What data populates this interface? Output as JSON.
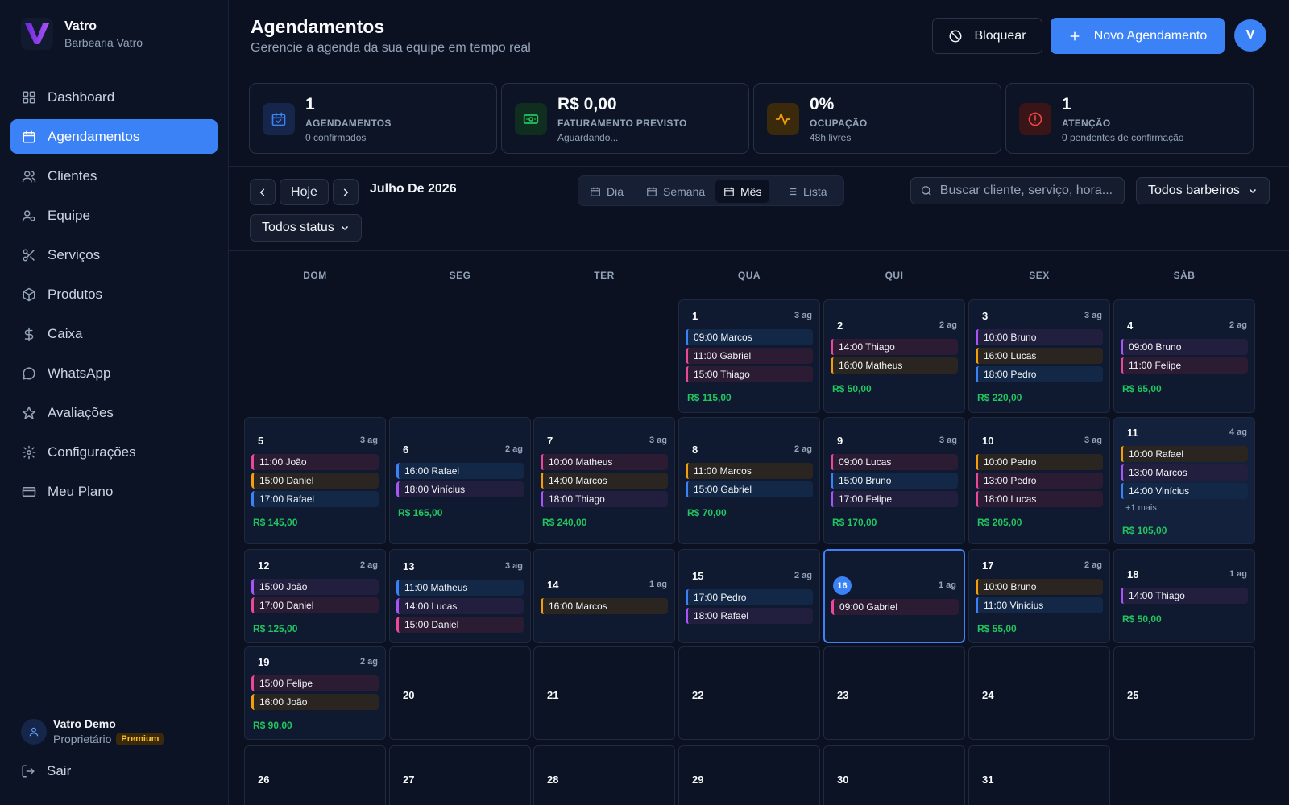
{
  "brand": {
    "name": "Vatro",
    "subtitle": "Barbearia Vatro"
  },
  "nav": [
    {
      "label": "Dashboard",
      "icon": "grid-icon"
    },
    {
      "label": "Agendamentos",
      "icon": "calendar-icon",
      "active": true
    },
    {
      "label": "Clientes",
      "icon": "users-icon"
    },
    {
      "label": "Equipe",
      "icon": "user-cog-icon"
    },
    {
      "label": "Serviços",
      "icon": "scissors-icon"
    },
    {
      "label": "Produtos",
      "icon": "package-icon"
    },
    {
      "label": "Caixa",
      "icon": "dollar-icon"
    },
    {
      "label": "WhatsApp",
      "icon": "message-icon"
    },
    {
      "label": "Avaliações",
      "icon": "star-icon"
    },
    {
      "label": "Configurações",
      "icon": "gear-icon"
    },
    {
      "label": "Meu Plano",
      "icon": "credit-card-icon"
    }
  ],
  "user": {
    "name": "Vatro Demo",
    "role": "Proprietário",
    "badge": "Premium",
    "logout": "Sair"
  },
  "header": {
    "title": "Agendamentos",
    "subtitle": "Gerencie a agenda da sua equipe em tempo real",
    "block_label": "Bloquear",
    "new_label": "Novo Agendamento",
    "avatar": "V"
  },
  "stats": [
    {
      "value": "1",
      "label": "AGENDAMENTOS",
      "sub": "0 confirmados",
      "icon": "calendar-check-icon",
      "color": "#3b82f6"
    },
    {
      "value": "R$ 0,00",
      "label": "FATURAMENTO PREVISTO",
      "sub": "Aguardando...",
      "icon": "banknote-icon",
      "color": "#22c55e"
    },
    {
      "value": "0%",
      "label": "OCUPAÇÃO",
      "sub": "48h livres",
      "icon": "activity-icon",
      "color": "#f59e0b"
    },
    {
      "value": "1",
      "label": "ATENÇÃO",
      "sub": "0 pendentes de confirmação",
      "icon": "alert-circle-icon",
      "color": "#ef4444"
    }
  ],
  "toolbar": {
    "today": "Hoje",
    "month": "Julho De 2026",
    "views": [
      "Dia",
      "Semana",
      "Mês",
      "Lista"
    ],
    "active_view": "Mês",
    "search_placeholder": "Buscar cliente, serviço, hora...",
    "barber_filter": "Todos barbeiros",
    "status_filter": "Todos status"
  },
  "calendar": {
    "weekdays": [
      "DOM",
      "SEG",
      "TER",
      "QUA",
      "QUI",
      "SEX",
      "SÁB"
    ],
    "colors": {
      "pink": "#ec4899",
      "orange": "#f59e0b",
      "blue": "#3b82f6",
      "purple": "#a855f7"
    },
    "days": [
      {
        "n": "1",
        "count": "3 ag",
        "appts": [
          [
            "09:00 Marcos",
            "blue"
          ],
          [
            "11:00 Gabriel",
            "pink"
          ],
          [
            "15:00 Thiago",
            "pink"
          ]
        ],
        "rev": "R$ 115,00"
      },
      {
        "n": "2",
        "count": "2 ag",
        "appts": [
          [
            "14:00 Thiago",
            "pink"
          ],
          [
            "16:00 Matheus",
            "orange"
          ]
        ],
        "rev": "R$ 50,00"
      },
      {
        "n": "3",
        "count": "3 ag",
        "appts": [
          [
            "10:00 Bruno",
            "purple"
          ],
          [
            "16:00 Lucas",
            "orange"
          ],
          [
            "18:00 Pedro",
            "blue"
          ]
        ],
        "rev": "R$ 220,00"
      },
      {
        "n": "4",
        "count": "2 ag",
        "appts": [
          [
            "09:00 Bruno",
            "purple"
          ],
          [
            "11:00 Felipe",
            "pink"
          ]
        ],
        "rev": "R$ 65,00"
      },
      {
        "n": "5",
        "count": "3 ag",
        "appts": [
          [
            "11:00 João",
            "pink"
          ],
          [
            "15:00 Daniel",
            "orange"
          ],
          [
            "17:00 Rafael",
            "blue"
          ]
        ],
        "rev": "R$ 145,00"
      },
      {
        "n": "6",
        "count": "2 ag",
        "appts": [
          [
            "16:00 Rafael",
            "blue"
          ],
          [
            "18:00 Vinícius",
            "purple"
          ]
        ],
        "rev": "R$ 165,00"
      },
      {
        "n": "7",
        "count": "3 ag",
        "appts": [
          [
            "10:00 Matheus",
            "pink"
          ],
          [
            "14:00 Marcos",
            "orange"
          ],
          [
            "18:00 Thiago",
            "purple"
          ]
        ],
        "rev": "R$ 240,00"
      },
      {
        "n": "8",
        "count": "2 ag",
        "appts": [
          [
            "11:00 Marcos",
            "orange"
          ],
          [
            "15:00 Gabriel",
            "blue"
          ]
        ],
        "rev": "R$ 70,00"
      },
      {
        "n": "9",
        "count": "3 ag",
        "appts": [
          [
            "09:00 Lucas",
            "pink"
          ],
          [
            "15:00 Bruno",
            "blue"
          ],
          [
            "17:00 Felipe",
            "purple"
          ]
        ],
        "rev": "R$ 170,00"
      },
      {
        "n": "10",
        "count": "3 ag",
        "appts": [
          [
            "10:00 Pedro",
            "orange"
          ],
          [
            "13:00 Pedro",
            "pink"
          ],
          [
            "18:00 Lucas",
            "pink"
          ]
        ],
        "rev": "R$ 205,00"
      },
      {
        "n": "11",
        "count": "4 ag",
        "appts": [
          [
            "10:00 Rafael",
            "orange"
          ],
          [
            "13:00 Marcos",
            "purple"
          ],
          [
            "14:00 Vinícius",
            "blue"
          ]
        ],
        "more": "+1 mais",
        "rev": "R$ 105,00",
        "highlight": true
      },
      {
        "n": "12",
        "count": "2 ag",
        "appts": [
          [
            "15:00 João",
            "purple"
          ],
          [
            "17:00 Daniel",
            "pink"
          ]
        ],
        "rev": "R$ 125,00"
      },
      {
        "n": "13",
        "count": "3 ag",
        "appts": [
          [
            "11:00 Matheus",
            "blue"
          ],
          [
            "14:00 Lucas",
            "purple"
          ],
          [
            "15:00 Daniel",
            "pink"
          ]
        ],
        "rev": ""
      },
      {
        "n": "14",
        "count": "1 ag",
        "appts": [
          [
            "16:00 Marcos",
            "orange"
          ]
        ],
        "rev": ""
      },
      {
        "n": "15",
        "count": "2 ag",
        "appts": [
          [
            "17:00 Pedro",
            "blue"
          ],
          [
            "18:00 Rafael",
            "purple"
          ]
        ],
        "rev": ""
      },
      {
        "n": "16",
        "count": "1 ag",
        "appts": [
          [
            "09:00 Gabriel",
            "pink"
          ]
        ],
        "rev": "",
        "today": true
      },
      {
        "n": "17",
        "count": "2 ag",
        "appts": [
          [
            "10:00 Bruno",
            "orange"
          ],
          [
            "11:00 Vinícius",
            "blue"
          ]
        ],
        "rev": "R$ 55,00"
      },
      {
        "n": "18",
        "count": "1 ag",
        "appts": [
          [
            "14:00 Thiago",
            "purple"
          ]
        ],
        "rev": "R$ 50,00"
      },
      {
        "n": "19",
        "count": "2 ag",
        "appts": [
          [
            "15:00 Felipe",
            "pink"
          ],
          [
            "16:00 João",
            "orange"
          ]
        ],
        "rev": "R$ 90,00"
      },
      {
        "n": "20"
      },
      {
        "n": "21"
      },
      {
        "n": "22"
      },
      {
        "n": "23"
      },
      {
        "n": "24"
      },
      {
        "n": "25"
      },
      {
        "n": "26"
      },
      {
        "n": "27"
      },
      {
        "n": "28"
      },
      {
        "n": "29"
      },
      {
        "n": "30"
      },
      {
        "n": "31"
      }
    ]
  }
}
